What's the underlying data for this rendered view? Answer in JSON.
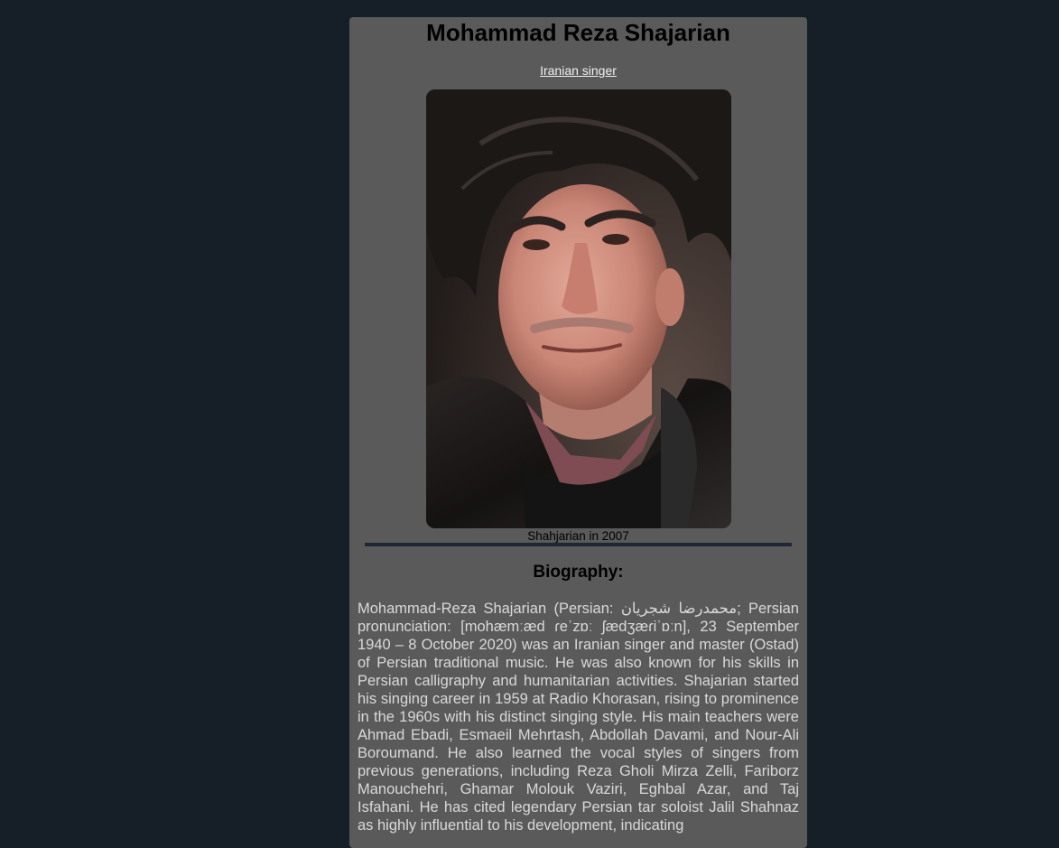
{
  "profile": {
    "name": "Mohammad Reza Shajarian",
    "subtitle": "Iranian singer",
    "image_caption": "Shahjarian in 2007"
  },
  "biography": {
    "heading": "Biography:",
    "text": "Mohammad-Reza Shajarian (Persian: محمدرضا شجریان; Persian pronunciation: [mohæmːæd ɾeˈzɒː ʃædʒæɾiˈɒːn], 23 September 1940 – 8 October 2020) was an Iranian singer and master (Ostad) of Persian traditional music. He was also known for his skills in Persian calligraphy and humanitarian activities. Shajarian started his singing career in 1959 at Radio Khorasan, rising to prominence in the 1960s with his distinct singing style. His main teachers were Ahmad Ebadi, Esmaeil Mehrtash, Abdollah Davami, and Nour-Ali Boroumand. He also learned the vocal styles of singers from previous generations, including Reza Gholi Mirza Zelli, Fariborz Manouchehri, Ghamar Molouk Vaziri, Eghbal Azar, and Taj Isfahani. He has cited legendary Persian tar soloist Jalil Shahnaz as highly influential to his development, indicating"
  },
  "colors": {
    "page_background": "#161e27",
    "card_background": "#5a5a5a",
    "divider": "#1f2735",
    "body_text": "#d9d9d9"
  }
}
